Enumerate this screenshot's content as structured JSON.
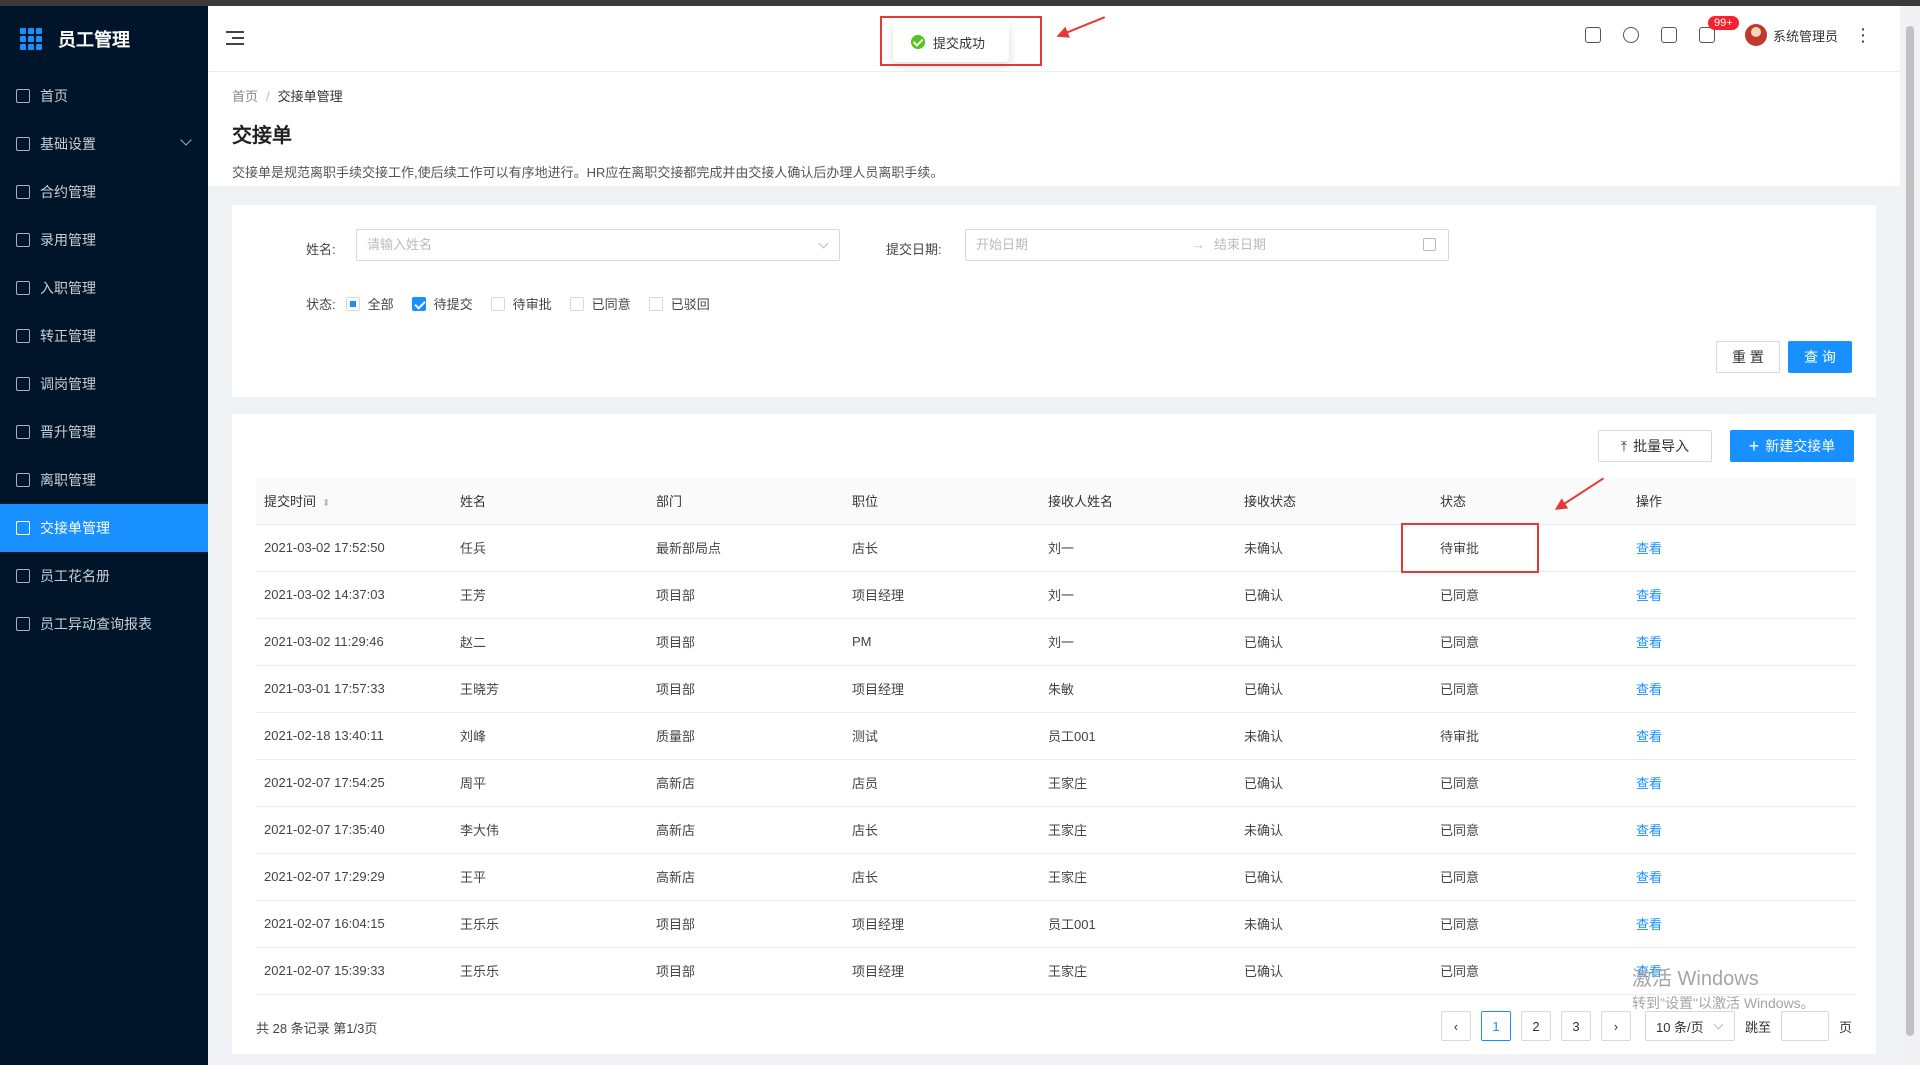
{
  "app": {
    "title": "员工管理"
  },
  "sidebar": {
    "items": [
      {
        "label": "首页",
        "active": false,
        "expandable": false
      },
      {
        "label": "基础设置",
        "active": false,
        "expandable": true
      },
      {
        "label": "合约管理",
        "active": false,
        "expandable": false
      },
      {
        "label": "录用管理",
        "active": false,
        "expandable": false
      },
      {
        "label": "入职管理",
        "active": false,
        "expandable": false
      },
      {
        "label": "转正管理",
        "active": false,
        "expandable": false
      },
      {
        "label": "调岗管理",
        "active": false,
        "expandable": false
      },
      {
        "label": "晋升管理",
        "active": false,
        "expandable": false
      },
      {
        "label": "离职管理",
        "active": false,
        "expandable": false
      },
      {
        "label": "交接单管理",
        "active": true,
        "expandable": false
      },
      {
        "label": "员工花名册",
        "active": false,
        "expandable": false
      },
      {
        "label": "员工异动查询报表",
        "active": false,
        "expandable": false
      }
    ]
  },
  "header": {
    "notification_badge": "99+",
    "username": "系统管理员",
    "icons": [
      "home-icon",
      "help-icon",
      "apps-icon",
      "bell-icon"
    ]
  },
  "toast": {
    "message": "提交成功"
  },
  "page": {
    "breadcrumb": [
      "首页",
      "交接单管理"
    ],
    "title": "交接单",
    "description": "交接单是规范离职手续交接工作,使后续工作可以有序地进行。HR应在离职交接都完成并由交接人确认后办理人员离职手续。"
  },
  "filter": {
    "name_label": "姓名:",
    "name_placeholder": "请输入姓名",
    "date_label": "提交日期:",
    "date_start_placeholder": "开始日期",
    "date_end_placeholder": "结束日期",
    "date_separator": "→",
    "status_label": "状态:",
    "status_options": [
      {
        "label": "全部",
        "state": "indeterminate"
      },
      {
        "label": "待提交",
        "state": "checked"
      },
      {
        "label": "待审批",
        "state": "unchecked"
      },
      {
        "label": "已同意",
        "state": "unchecked"
      },
      {
        "label": "已驳回",
        "state": "unchecked"
      }
    ],
    "reset_label": "重 置",
    "search_label": "查 询"
  },
  "toolbar": {
    "import_label": "批量导入",
    "new_label": "新建交接单"
  },
  "table": {
    "columns": [
      "提交时间",
      "姓名",
      "部门",
      "职位",
      "接收人姓名",
      "接收状态",
      "状态",
      "操作"
    ],
    "rows": [
      [
        "2021-03-02 17:52:50",
        "任兵",
        "最新部局点",
        "店长",
        "刘一",
        "未确认",
        "待审批",
        "查看"
      ],
      [
        "2021-03-02 14:37:03",
        "王芳",
        "项目部",
        "项目经理",
        "刘一",
        "已确认",
        "已同意",
        "查看"
      ],
      [
        "2021-03-02 11:29:46",
        "赵二",
        "项目部",
        "PM",
        "刘一",
        "已确认",
        "已同意",
        "查看"
      ],
      [
        "2021-03-01 17:57:33",
        "王晓芳",
        "项目部",
        "项目经理",
        "朱敏",
        "已确认",
        "已同意",
        "查看"
      ],
      [
        "2021-02-18 13:40:11",
        "刘峰",
        "质量部",
        "测试",
        "员工001",
        "未确认",
        "待审批",
        "查看"
      ],
      [
        "2021-02-07 17:54:25",
        "周平",
        "高新店",
        "店员",
        "王家庄",
        "已确认",
        "已同意",
        "查看"
      ],
      [
        "2021-02-07 17:35:40",
        "李大伟",
        "高新店",
        "店长",
        "王家庄",
        "未确认",
        "已同意",
        "查看"
      ],
      [
        "2021-02-07 17:29:29",
        "王平",
        "高新店",
        "店长",
        "王家庄",
        "已确认",
        "已同意",
        "查看"
      ],
      [
        "2021-02-07 16:04:15",
        "王乐乐",
        "项目部",
        "项目经理",
        "员工001",
        "未确认",
        "已同意",
        "查看"
      ],
      [
        "2021-02-07 15:39:33",
        "王乐乐",
        "项目部",
        "项目经理",
        "王家庄",
        "已确认",
        "已同意",
        "查看"
      ]
    ]
  },
  "pagination": {
    "summary": "共 28 条记录 第1/3页",
    "pages": [
      "1",
      "2",
      "3"
    ],
    "current_page": "1",
    "page_size": "10 条/页",
    "jump_label": "跳至",
    "page_unit": "页"
  },
  "watermark": {
    "line1": "激活 Windows",
    "line2": "转到\"设置\"以激活 Windows。"
  },
  "colors": {
    "primary": "#1890ff",
    "sidebar": "#001529",
    "success": "#52c41a",
    "annotation": "#e53935"
  }
}
